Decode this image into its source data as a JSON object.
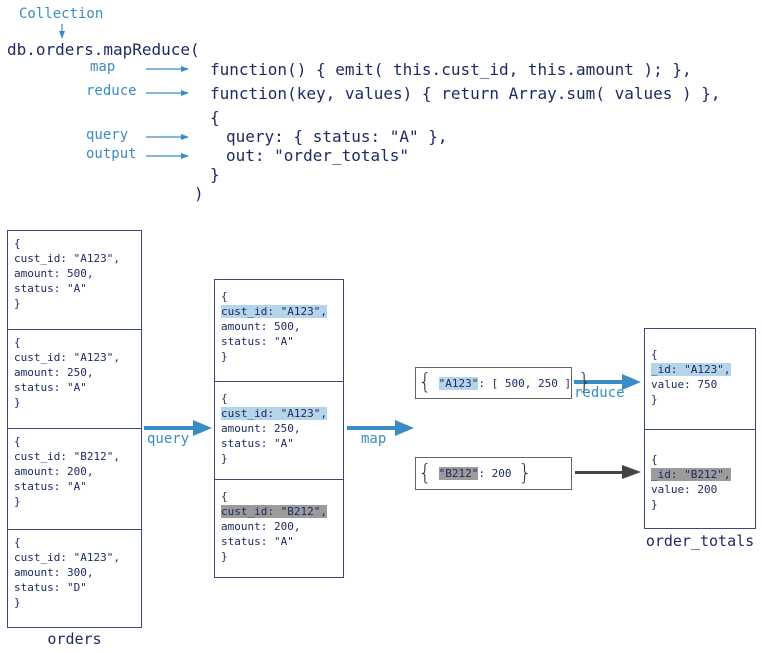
{
  "header": {
    "collection_label": "Collection",
    "call_open": "db.orders.mapReduce(",
    "call_close": ")"
  },
  "params": [
    {
      "label": "map",
      "code": "function() { emit( this.cust_id, this.amount ); },"
    },
    {
      "label": "reduce",
      "code": "function(key, values) { return Array.sum( values ) },"
    },
    {
      "label": "query",
      "code": "query: { status: \"A\" },"
    },
    {
      "label": "output",
      "code": "out: \"order_totals\""
    }
  ],
  "options_open": "{",
  "options_close": "}",
  "orders": {
    "caption": "orders",
    "docs": [
      {
        "cust_id": "\"A123\"",
        "amount": "500",
        "status": "\"A\""
      },
      {
        "cust_id": "\"A123\"",
        "amount": "250",
        "status": "\"A\""
      },
      {
        "cust_id": "\"B212\"",
        "amount": "200",
        "status": "\"A\""
      },
      {
        "cust_id": "\"A123\"",
        "amount": "300",
        "status": "\"D\""
      }
    ]
  },
  "filtered": {
    "docs": [
      {
        "cust_id": "\"A123\"",
        "amount": "500",
        "status": "\"A\"",
        "highlight": "blue"
      },
      {
        "cust_id": "\"A123\"",
        "amount": "250",
        "status": "\"A\"",
        "highlight": "blue"
      },
      {
        "cust_id": "\"B212\"",
        "amount": "200",
        "status": "\"A\"",
        "highlight": "gray"
      }
    ]
  },
  "stages": {
    "query_label": "query",
    "map_label": "map",
    "reduce_label": "reduce"
  },
  "mapped": [
    {
      "key": "\"A123\"",
      "rest": ": [ 500, 250 ]",
      "highlight": "blue"
    },
    {
      "key": "\"B212\"",
      "rest": ": 200",
      "highlight": "gray"
    }
  ],
  "order_totals": {
    "caption": "order_totals",
    "docs": [
      {
        "id": "\"A123\"",
        "value": "750",
        "highlight": "blue"
      },
      {
        "id": "\"B212\"",
        "value": "200",
        "highlight": "gray"
      }
    ]
  },
  "colors": {
    "accent": "#3a8cc6",
    "text": "#1e2a63",
    "highlight_blue": "#b4d4ea",
    "highlight_gray": "#9b9b9b",
    "dark_arrow": "#444444"
  }
}
